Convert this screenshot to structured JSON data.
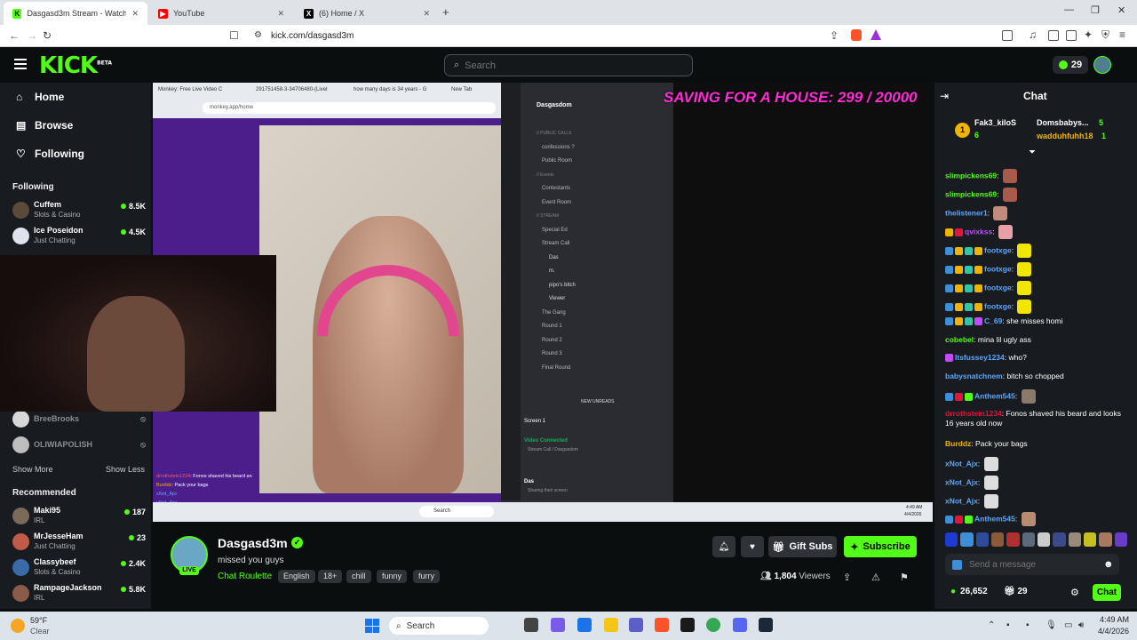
{
  "browser": {
    "tabs": [
      {
        "title": "Dasgasd3m Stream - Watch L",
        "favicon": "kick-icon",
        "color": "#53fc18"
      },
      {
        "title": "YouTube",
        "favicon": "youtube-icon",
        "color": "#ff0000"
      },
      {
        "title": "(6) Home / X",
        "favicon": "x-icon",
        "color": "#000000"
      }
    ],
    "url": "kick.com/dasgasd3m"
  },
  "header": {
    "logo": "KICK",
    "logo_beta": "BETA",
    "search_placeholder": "Search",
    "kicks_count": "29"
  },
  "sidebar": {
    "nav": [
      {
        "label": "Home",
        "icon": "home-icon"
      },
      {
        "label": "Browse",
        "icon": "browse-icon"
      },
      {
        "label": "Following",
        "icon": "heart-icon"
      }
    ],
    "following_title": "Following",
    "following": [
      {
        "name": "Cuffem",
        "category": "Slots & Casino",
        "viewers": "8.5K"
      },
      {
        "name": "Ice Poseidon",
        "category": "Just Chatting",
        "viewers": "4.5K"
      }
    ],
    "offline": [
      {
        "name": "BreeBrooks"
      },
      {
        "name": "OLIWIAPOLISH"
      }
    ],
    "show_more": "Show More",
    "show_less": "Show Less",
    "recommended_title": "Recommended",
    "recommended": [
      {
        "name": "Maki95",
        "category": "IRL",
        "viewers": "187"
      },
      {
        "name": "MrJesseHam",
        "category": "Just Chatting",
        "viewers": "23"
      },
      {
        "name": "Classybeef",
        "category": "Slots & Casino",
        "viewers": "2.4K"
      },
      {
        "name": "RampageJackson",
        "category": "IRL",
        "viewers": "5.8K"
      }
    ]
  },
  "video": {
    "overlay_goal": "SAVING FOR A HOUSE: 299 / 20000",
    "inner_url": "monkey.app/home",
    "inner_tabs": [
      "Monkey: Free Live Video C",
      "291751458-3-34706480-(Livel",
      "how many days is 34 years - G",
      "New Tab"
    ],
    "discord_server": "Dasgasdom",
    "discord_sections": [
      {
        "text": "// PUBLIC CALLS",
        "type": "head"
      },
      {
        "text": "confessions ?",
        "type": "ch"
      },
      {
        "text": "Public Room",
        "type": "ch"
      },
      {
        "text": "// Events",
        "type": "head"
      },
      {
        "text": "Contestants",
        "type": "ch"
      },
      {
        "text": "Event Room",
        "type": "ch"
      },
      {
        "text": "// STREAM",
        "type": "head"
      },
      {
        "text": "Special Ed",
        "type": "ch"
      },
      {
        "text": "Stream Call",
        "type": "ch"
      },
      {
        "text": "Das",
        "type": "user"
      },
      {
        "text": "m.",
        "type": "user"
      },
      {
        "text": "pipo's bitch",
        "type": "user"
      },
      {
        "text": "Viewer",
        "type": "user"
      },
      {
        "text": "The Gang",
        "type": "ch"
      },
      {
        "text": "Round 1",
        "type": "ch"
      },
      {
        "text": "Round 2",
        "type": "ch"
      },
      {
        "text": "Round 3",
        "type": "ch"
      },
      {
        "text": "Final Round",
        "type": "ch"
      }
    ],
    "discord_screen": "Screen 1",
    "discord_voice": "Video Connected",
    "discord_voice_sub": "Stream Call / Dasgasdom",
    "discord_user": "Das",
    "discord_user_status": "Sharing their screen",
    "new_unreads": "NEW UNREADS",
    "inner_chat": [
      {
        "user": "drrothstein1234",
        "text": "Fonos shaved his beard an"
      },
      {
        "user": "Burddz",
        "text": "Pack your bags"
      },
      {
        "user": "xNot_Ajx",
        "text": ""
      },
      {
        "user": "xNot_Ajx",
        "text": ""
      }
    ],
    "inner_taskbar_search": "Search",
    "inner_clock": "4:49 AM",
    "inner_date": "4/4/2026"
  },
  "stream": {
    "name": "Dasgasd3m",
    "title": "missed you guys",
    "category": "Chat Roulette",
    "tags": [
      "English",
      "18+",
      "chill",
      "funny",
      "furry"
    ],
    "viewers": "1,804",
    "viewers_label": "Viewers",
    "live": "LIVE",
    "gift_label": "Gift Subs",
    "subscribe_label": "Subscribe"
  },
  "chat": {
    "title": "Chat",
    "top_gifters": [
      {
        "rank": "1",
        "name": "Fak3_kiloS",
        "count": "6"
      },
      {
        "name": "Domsbabys...",
        "count": "5"
      },
      {
        "name": "wadduhfuhh18",
        "count": "1"
      }
    ],
    "messages": [
      {
        "user": "slimpickens69",
        "text": "",
        "color": "#53fc18",
        "emote": "#a85b4b",
        "badges": []
      },
      {
        "user": "slimpickens69",
        "text": "",
        "color": "#53fc18",
        "emote": "#a85b4b",
        "badges": []
      },
      {
        "user": "thelistener1",
        "text": "",
        "color": "#5ca8ff",
        "emote": "#c28b7a",
        "badges": []
      },
      {
        "user": "qvixkss",
        "text": "",
        "color": "#c14cff",
        "emote": "#e8a0a8",
        "badges": [
          "#f0b400",
          "#e0163c"
        ]
      },
      {
        "user": "footxge",
        "text": "",
        "color": "#5ca8ff",
        "emote": "#f2e500",
        "badges": [
          "#3f8fd8",
          "#f0b400",
          "#35c4a5",
          "#f0b400"
        ]
      },
      {
        "user": "footxge",
        "text": "",
        "color": "#5ca8ff",
        "emote": "#f2e500",
        "badges": [
          "#3f8fd8",
          "#f0b400",
          "#35c4a5",
          "#f0b400"
        ]
      },
      {
        "user": "footxge",
        "text": "",
        "color": "#5ca8ff",
        "emote": "#f2e500",
        "badges": [
          "#3f8fd8",
          "#f0b400",
          "#35c4a5",
          "#f0b400"
        ]
      },
      {
        "user": "footxge",
        "text": "",
        "color": "#5ca8ff",
        "emote": "#f2e500",
        "badges": [
          "#3f8fd8",
          "#f0b400",
          "#35c4a5",
          "#f0b400"
        ]
      },
      {
        "user": "C_69",
        "text": "she misses homi",
        "color": "#5ca8ff",
        "emote": "",
        "badges": [
          "#3f8fd8",
          "#f0b400",
          "#35c4a5",
          "#c14cff"
        ]
      },
      {
        "user": "cobebel",
        "text": "mina lil ugly ass",
        "color": "#53fc18",
        "emote": "",
        "badges": []
      },
      {
        "user": "Itsfussey1234",
        "text": "who?",
        "color": "#5ca8ff",
        "emote": "",
        "badges": [
          "#c14cff"
        ]
      },
      {
        "user": "babysnatchnem",
        "text": "bitch so chopped",
        "color": "#5ca8ff",
        "emote": "",
        "badges": []
      },
      {
        "user": "Anthem545",
        "text": "",
        "color": "#5ca8ff",
        "emote": "#8a7a6a",
        "badges": [
          "#3f8fd8",
          "#e0163c",
          "#53fc18"
        ]
      },
      {
        "user": "drrothstein1234",
        "text": "Fonos shaved his beard and looks 16 years old now",
        "color": "#e0163c",
        "emote": "",
        "badges": []
      },
      {
        "user": "Burddz",
        "text": "Pack your bags",
        "color": "#f0b400",
        "emote": "",
        "badges": []
      },
      {
        "user": "xNot_Ajx",
        "text": "",
        "color": "#5ca8ff",
        "emote": "#dddddd",
        "badges": []
      },
      {
        "user": "xNot_Ajx",
        "text": "",
        "color": "#5ca8ff",
        "emote": "#dddddd",
        "badges": []
      },
      {
        "user": "xNot_Ajx",
        "text": "",
        "color": "#5ca8ff",
        "emote": "#dddddd",
        "badges": []
      },
      {
        "user": "Anthem545",
        "text": "",
        "color": "#5ca8ff",
        "emote": "#b88c70",
        "badges": [
          "#3f8fd8",
          "#e0163c",
          "#53fc18"
        ]
      }
    ],
    "input_placeholder": "Send a message",
    "points": "26,652",
    "gifts": "29",
    "chat_button": "Chat"
  },
  "taskbar": {
    "weather_temp": "59°F",
    "weather_desc": "Clear",
    "search_label": "Search",
    "time": "4:49 AM",
    "date": "4/4/2026"
  },
  "colors": {
    "accent": "#53fc18",
    "goal_pink": "#ff2bd6"
  }
}
